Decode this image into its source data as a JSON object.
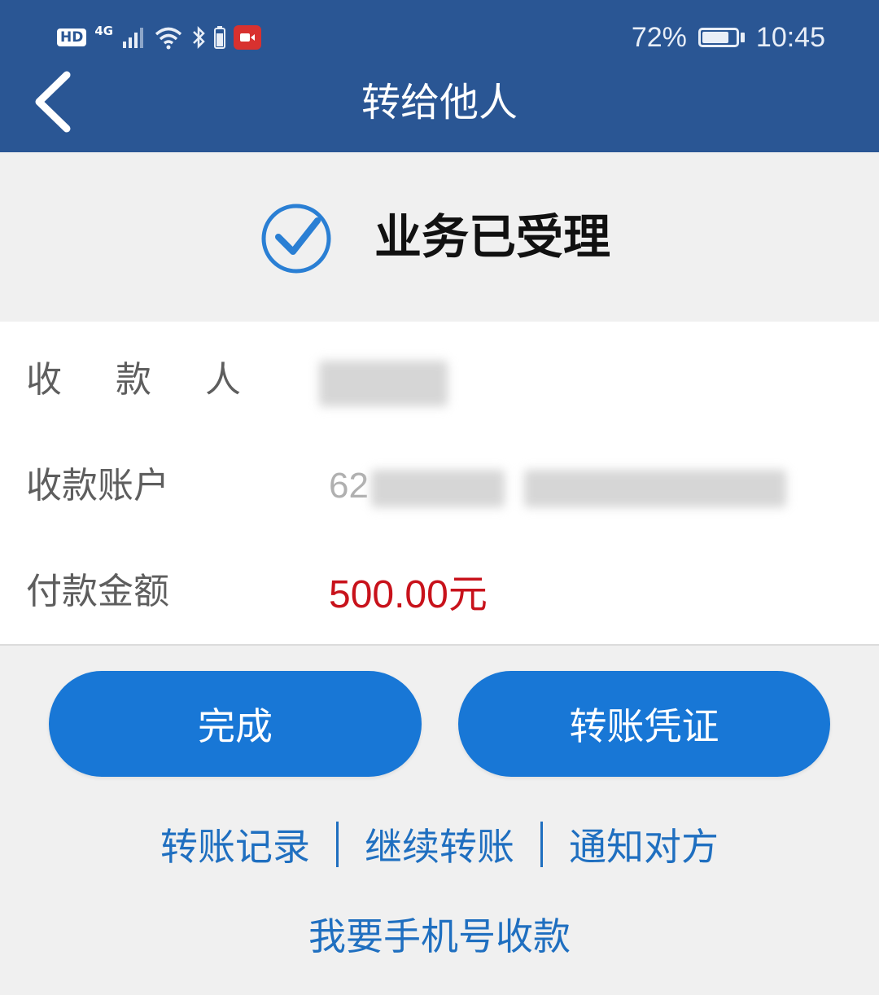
{
  "status_bar": {
    "hd_label": "HD",
    "network_label": "4G",
    "battery_percent": "72%",
    "battery_level": 0.72,
    "time": "10:45",
    "icons": [
      "hd-icon",
      "signal-icon",
      "wifi-icon",
      "bluetooth-icon",
      "screen-record-icon",
      "battery-icon"
    ]
  },
  "header": {
    "title": "转给他人",
    "back_icon": "chevron-left-icon"
  },
  "result": {
    "icon": "check-circle-icon",
    "text": "业务已受理",
    "accent_color": "#2a7fd4"
  },
  "details": {
    "payee_label": "收 款 人",
    "account_label": "收款账户",
    "account_prefix": "62",
    "amount_label": "付款金额",
    "amount_value": "500.00元"
  },
  "actions": {
    "done_label": "完成",
    "voucher_label": "转账凭证"
  },
  "links": {
    "records": "转账记录",
    "continue": "继续转账",
    "notify": "通知对方",
    "phone_receive": "我要手机号收款"
  },
  "colors": {
    "header_bg": "#2a5694",
    "button_bg": "#1877d6",
    "link": "#1f6fc0",
    "amount": "#c8121b"
  }
}
